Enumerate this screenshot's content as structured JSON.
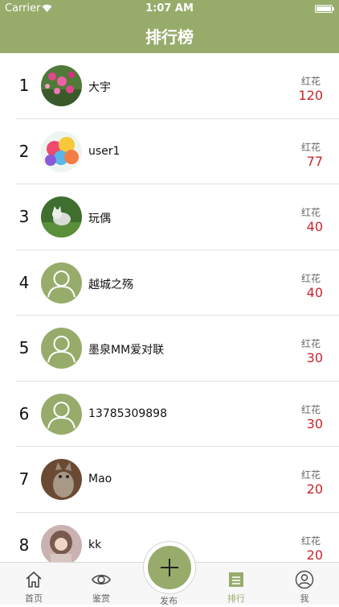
{
  "status_bar": {
    "carrier": "Carrier",
    "time": "1:07 AM"
  },
  "nav": {
    "title": "排行榜"
  },
  "colors": {
    "accent": "#97ac6b",
    "count": "#c8252c"
  },
  "ranking": [
    {
      "rank": "1",
      "name": "大宇",
      "flower_label": "红花",
      "count": "120",
      "avatar": "flowers-photo"
    },
    {
      "rank": "2",
      "name": "user1",
      "flower_label": "红花",
      "count": "77",
      "avatar": "balloons-photo"
    },
    {
      "rank": "3",
      "name": "玩偶",
      "flower_label": "红花",
      "count": "40",
      "avatar": "cat-on-grass-photo"
    },
    {
      "rank": "4",
      "name": "越城之殇",
      "flower_label": "红花",
      "count": "40",
      "avatar": "default-person"
    },
    {
      "rank": "5",
      "name": "墨泉MM爱对联",
      "flower_label": "红花",
      "count": "30",
      "avatar": "default-person"
    },
    {
      "rank": "6",
      "name": "13785309898",
      "flower_label": "红花",
      "count": "30",
      "avatar": "default-person"
    },
    {
      "rank": "7",
      "name": "Mao",
      "flower_label": "红花",
      "count": "20",
      "avatar": "cat-photo"
    },
    {
      "rank": "8",
      "name": "kk",
      "flower_label": "红花",
      "count": "20",
      "avatar": "girl-photo"
    }
  ],
  "tabs": [
    {
      "label": "首页",
      "icon": "home-icon"
    },
    {
      "label": "鉴赏",
      "icon": "eye-icon"
    },
    {
      "label": "发布",
      "icon": "plus-icon"
    },
    {
      "label": "排行",
      "icon": "list-icon"
    },
    {
      "label": "我",
      "icon": "person-icon"
    }
  ]
}
